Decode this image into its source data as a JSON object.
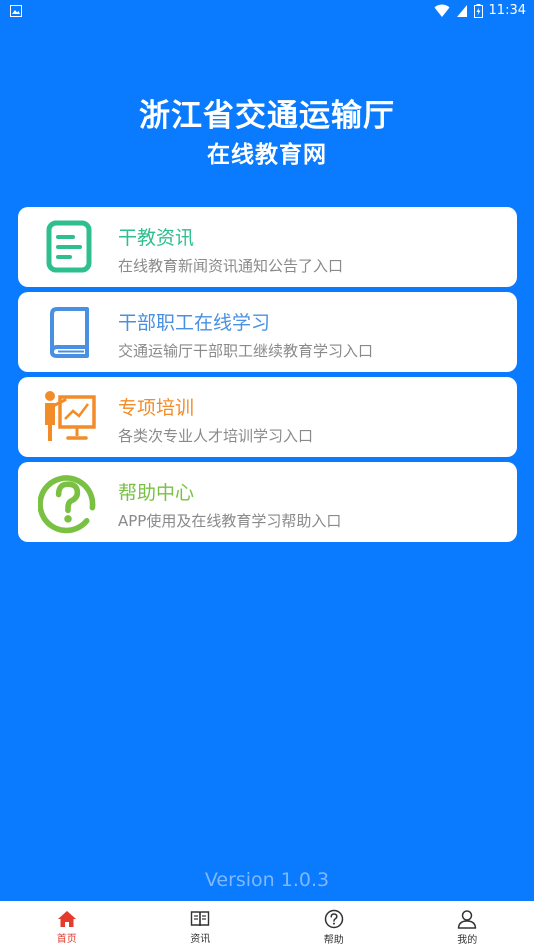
{
  "status_bar": {
    "time": "11:34"
  },
  "header": {
    "title": "浙江省交通运输厅",
    "subtitle": "在线教育网"
  },
  "menu": [
    {
      "title": "干教资讯",
      "desc": "在线教育新闻资讯通知公告了入口",
      "color": "#2fbf8f",
      "icon": "news-icon"
    },
    {
      "title": "干部职工在线学习",
      "desc": "交通运输厅干部职工继续教育学习入口",
      "color": "#4a90e2",
      "icon": "book-icon"
    },
    {
      "title": "专项培训",
      "desc": "各类次专业人才培训学习入口",
      "color": "#f28c28",
      "icon": "presentation-icon"
    },
    {
      "title": "帮助中心",
      "desc": "APP使用及在线教育学习帮助入口",
      "color": "#7ac143",
      "icon": "question-icon"
    }
  ],
  "version": "Version 1.0.3",
  "bottom_nav": [
    {
      "label": "首页",
      "icon": "home-icon",
      "active": true
    },
    {
      "label": "资讯",
      "icon": "news-book-icon",
      "active": false
    },
    {
      "label": "帮助",
      "icon": "help-icon",
      "active": false
    },
    {
      "label": "我的",
      "icon": "user-icon",
      "active": false
    }
  ],
  "colors": {
    "background": "#0a7bff",
    "nav_active": "#e33b2d"
  }
}
